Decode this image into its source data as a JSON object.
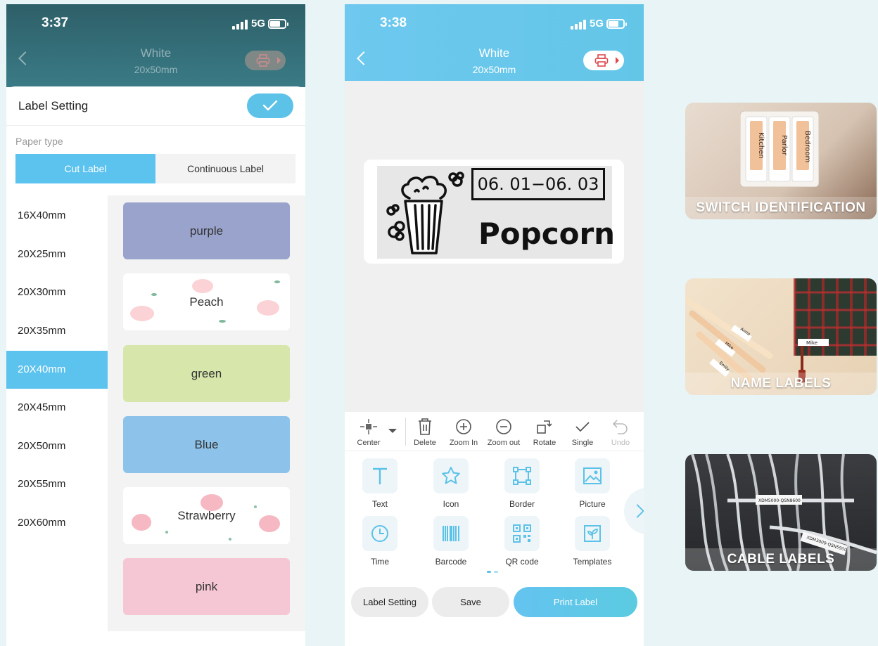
{
  "screen1": {
    "status": {
      "time": "3:37",
      "network": "5G"
    },
    "nav": {
      "title": "White",
      "subtitle": "20x50mm"
    },
    "sheet": {
      "title": "Label Setting",
      "paper_type_label": "Paper type",
      "paper_types": [
        "Cut Label",
        "Continuous Label"
      ],
      "selected_paper_type": "Cut Label",
      "sizes": [
        "16X40mm",
        "20X25mm",
        "20X30mm",
        "20X35mm",
        "20X40mm",
        "20X45mm",
        "20X50mm",
        "20X55mm",
        "20X60mm"
      ],
      "selected_size": "20X40mm",
      "colors": [
        {
          "name": "purple",
          "bg": "#9aa3cb"
        },
        {
          "name": "Peach",
          "bg": "#ffffff"
        },
        {
          "name": "green",
          "bg": "#d7e7ab"
        },
        {
          "name": "Blue",
          "bg": "#8dc3ea"
        },
        {
          "name": "Strawberry",
          "bg": "#ffffff"
        },
        {
          "name": "pink",
          "bg": "#f5c6d3"
        }
      ]
    }
  },
  "screen2": {
    "status": {
      "time": "3:38",
      "network": "5G"
    },
    "nav": {
      "title": "White",
      "subtitle": "20x50mm"
    },
    "canvas": {
      "date_text": "06. 01−06. 03",
      "main_text": "Popcorn"
    },
    "toolbar": [
      "Center",
      "Delete",
      "Zoom In",
      "Zoom out",
      "Rotate",
      "Single",
      "Undo"
    ],
    "elements": [
      "Text",
      "Icon",
      "Border",
      "Picture",
      "Time",
      "Barcode",
      "QR code",
      "Templates"
    ],
    "buttons": {
      "label_setting": "Label Setting",
      "save": "Save",
      "print": "Print Label"
    }
  },
  "features": [
    {
      "caption": "SWITCH IDENTIFICATION",
      "labels": [
        "Kitchen",
        "Parlor",
        "Bedroom"
      ]
    },
    {
      "caption": "NAME LABELS",
      "labels": [
        "Anna",
        "Mike",
        "Emily",
        "Mike"
      ]
    },
    {
      "caption": "CABLE LABELS",
      "labels": [
        "XDM5000-QSN8600",
        "XDM3000-QSN5900"
      ]
    }
  ],
  "colors": {
    "accent": "#5cc2ee",
    "header_dark": "#2e5f68",
    "print_icon": "#e0484c"
  }
}
